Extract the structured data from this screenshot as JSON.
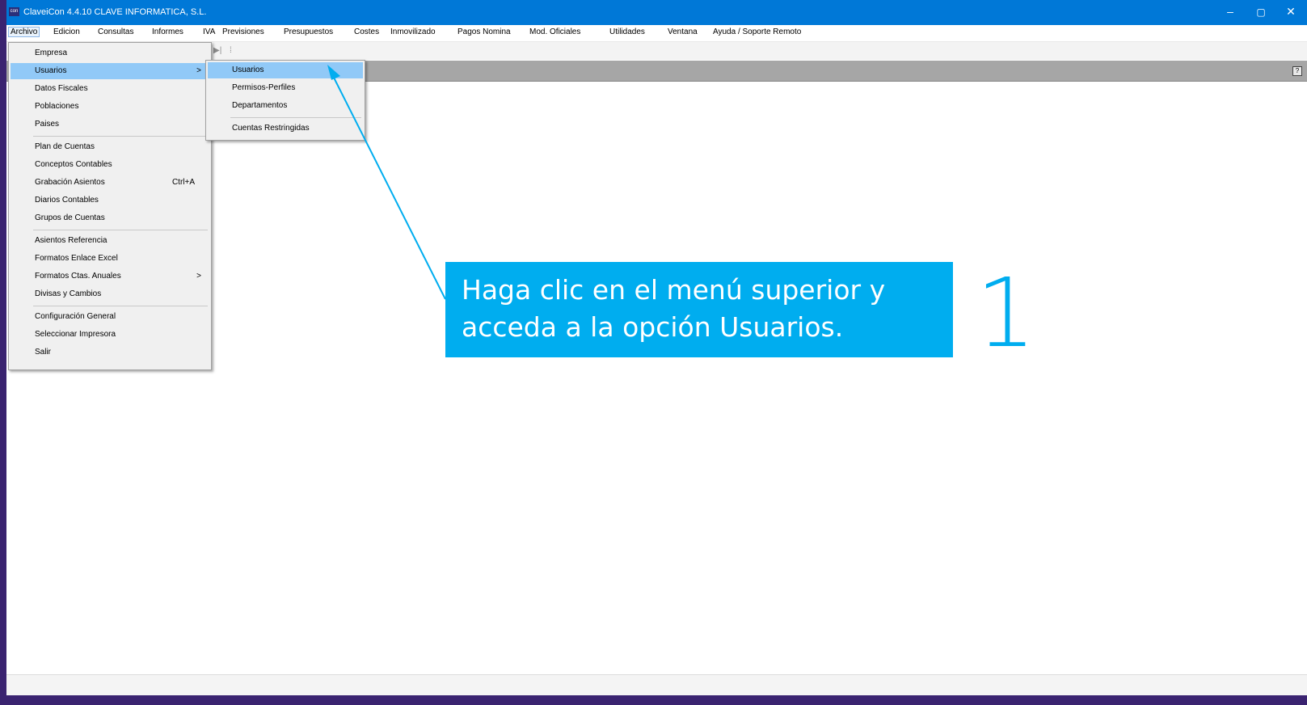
{
  "window": {
    "title": "ClaveiCon 4.4.10 CLAVE INFORMATICA, S.L.",
    "icon_text": "con",
    "controls": [
      "–",
      "▢",
      "✕"
    ]
  },
  "menubar": [
    "Archivo",
    "Edicion",
    "Consultas",
    "Informes",
    "IVA",
    "Previsiones",
    "Presupuestos",
    "Costes",
    "Inmovilizado",
    "Pagos Nomina",
    "Mod. Oficiales",
    "Utilidades",
    "Ventana",
    "Ayuda / Soporte Remoto"
  ],
  "toolbar": {
    "icons": [
      "▶|",
      "⁞"
    ]
  },
  "graybar": {
    "help_icon": "?"
  },
  "archivo_menu": [
    {
      "label": "Empresa"
    },
    {
      "label": "Usuarios",
      "submenu": ">",
      "highlighted": true
    },
    {
      "label": "Datos Fiscales"
    },
    {
      "label": "Poblaciones"
    },
    {
      "label": "Paises"
    },
    {
      "label": "Plan de Cuentas"
    },
    {
      "label": "Conceptos Contables"
    },
    {
      "label": "Grabación Asientos",
      "shortcut": "Ctrl+A"
    },
    {
      "label": "Diarios Contables"
    },
    {
      "label": "Grupos de Cuentas"
    },
    {
      "label": "Asientos Referencia"
    },
    {
      "label": "Formatos Enlace Excel"
    },
    {
      "label": "Formatos Ctas. Anuales",
      "submenu": ">"
    },
    {
      "label": "Divisas y Cambios"
    },
    {
      "label": "Configuración General"
    },
    {
      "label": "Seleccionar Impresora"
    },
    {
      "label": "Salir"
    }
  ],
  "usuarios_submenu": [
    {
      "label": "Usuarios",
      "highlighted": true
    },
    {
      "label": "Permisos-Perfiles"
    },
    {
      "label": "Departamentos"
    },
    {
      "label": "Cuentas Restringidas"
    }
  ],
  "annotation": {
    "line1": "Haga clic en el menú superior y",
    "line2": "acceda a la opción Usuarios.",
    "step": "1",
    "color": "#00adef"
  }
}
